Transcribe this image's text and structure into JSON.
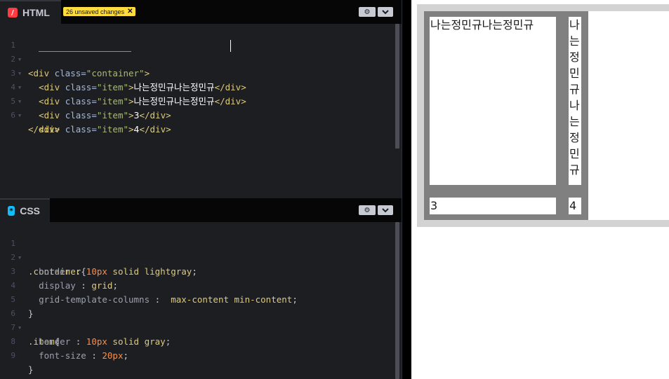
{
  "editor": {
    "html_pane": {
      "title": "HTML",
      "icon": "html-icon",
      "icon_glyph": "/",
      "unsaved_badge": "26 unsaved changes",
      "badge_close": "✕",
      "gear_glyph": "⚙",
      "chevron_glyph": "⌄",
      "line_numbers": [
        "1",
        "2",
        "3",
        "4",
        "5",
        "6"
      ],
      "lines": [
        {
          "open_tag": "<div",
          "attr": " class=",
          "value": "\"container\"",
          "close": ">",
          "text": "",
          "end_tag": ""
        },
        {
          "indent": "  ",
          "open_tag": "<div",
          "attr": " class=",
          "value": "\"item\"",
          "close": ">",
          "text": "나는정민규나는정민규",
          "end_tag": "</div>"
        },
        {
          "indent": "  ",
          "open_tag": "<div",
          "attr": " class=",
          "value": "\"item\"",
          "close": ">",
          "text": "나는정민규나는정민규",
          "end_tag": "</div>"
        },
        {
          "indent": "  ",
          "open_tag": "<div",
          "attr": " class=",
          "value": "\"item\"",
          "close": ">",
          "text": "3",
          "end_tag": "</div>"
        },
        {
          "indent": "  ",
          "open_tag": "<div",
          "attr": " class=",
          "value": "\"item\"",
          "close": ">",
          "text": "4",
          "end_tag": "</div>"
        },
        {
          "end_tag": "</div>"
        }
      ]
    },
    "css_pane": {
      "title": "CSS",
      "icon": "css-icon",
      "icon_glyph": "*",
      "gear_glyph": "⚙",
      "chevron_glyph": "⌄",
      "line_numbers": [
        "1",
        "2",
        "3",
        "4",
        "5",
        "6",
        "7",
        "8",
        "9"
      ],
      "lines": [
        {
          "selector": ".container",
          "brace": "{"
        },
        {
          "prop": "border",
          "sep": " : ",
          "num": "10px",
          "rest": " solid lightgray",
          "semi": ";"
        },
        {
          "prop": "display",
          "sep": " : ",
          "num": "",
          "rest": "grid",
          "semi": ";"
        },
        {
          "prop": "grid-template-columns",
          "sep": " :  ",
          "num": "",
          "rest": "max-content min-content",
          "semi": ";"
        },
        {
          "brace": "}"
        },
        {
          "selector": ".item",
          "brace": "{"
        },
        {
          "prop": "border",
          "sep": " : ",
          "num": "10px",
          "rest": " solid gray",
          "semi": ";"
        },
        {
          "prop": "font-size",
          "sep": " : ",
          "num": "20px",
          "rest": "",
          "semi": ";"
        },
        {
          "brace": "}"
        }
      ]
    }
  },
  "preview": {
    "items": [
      "나는정민규나는정민규",
      "나는정민규나는정민규",
      "3",
      "4"
    ],
    "colors": {
      "container_border": "#d3d3d3",
      "item_border": "#808080"
    }
  },
  "colors": {
    "editor_bg": "#1d1e22",
    "header_bg": "#060606",
    "tag": "#ddca7e",
    "attr": "#a8b8d4",
    "string": "#a7b97b",
    "number": "#ff8c42",
    "badge": "#ffdd40"
  }
}
